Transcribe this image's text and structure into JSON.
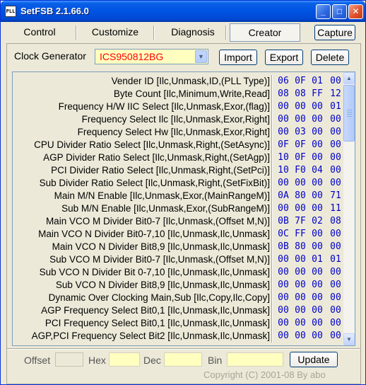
{
  "window": {
    "title": "SetFSB 2.1.66.0",
    "icon_label": "PLL",
    "controls": {
      "minimize": "_",
      "maximize": "□",
      "close": "✕"
    }
  },
  "tabs": [
    {
      "label": "Control",
      "active": false
    },
    {
      "label": "Customize",
      "active": false
    },
    {
      "label": "Diagnosis",
      "active": false
    },
    {
      "label": "Creator",
      "active": true
    }
  ],
  "capture_label": "Capture",
  "clock_generator": {
    "label": "Clock Generator",
    "selected": "ICS950812BG",
    "arrow": "▼",
    "import_label": "Import",
    "export_label": "Export",
    "delete_label": "Delete"
  },
  "rows": [
    {
      "label": "Vender ID [Ilc,Unmask,ID,(PLL Type)]",
      "v": [
        "06",
        "0F",
        "01",
        "00"
      ]
    },
    {
      "label": "Byte Count [Ilc,Minimum,Write,Read]",
      "v": [
        "08",
        "08",
        "FF",
        "12"
      ]
    },
    {
      "label": "Frequency H/W IIC Select [Ilc,Unmask,Exor,(flag)]",
      "v": [
        "00",
        "00",
        "00",
        "01"
      ]
    },
    {
      "label": "Frequency Select Ilc [Ilc,Unmask,Exor,Right]",
      "v": [
        "00",
        "00",
        "00",
        "00"
      ]
    },
    {
      "label": "Frequency Select Hw [Ilc,Unmask,Exor,Right]",
      "v": [
        "00",
        "03",
        "00",
        "00"
      ]
    },
    {
      "label": "CPU Divider Ratio Select [Ilc,Unmask,Right,(SetAsync)]",
      "v": [
        "0F",
        "0F",
        "00",
        "00"
      ]
    },
    {
      "label": "AGP Divider Ratio Select [Ilc,Unmask,Right,(SetAgp)]",
      "v": [
        "10",
        "0F",
        "00",
        "00"
      ]
    },
    {
      "label": "PCI Divider Ratio Select [Ilc,Unmask,Right,(SetPci)]",
      "v": [
        "10",
        "F0",
        "04",
        "00"
      ]
    },
    {
      "label": "Sub Divider Ratio Select [Ilc,Unmask,Right,(SetFixBit)]",
      "v": [
        "00",
        "00",
        "00",
        "00"
      ]
    },
    {
      "label": "Main M/N Enable [Ilc,Unmask,Exor,(MainRangeM)]",
      "v": [
        "0A",
        "80",
        "00",
        "71"
      ]
    },
    {
      "label": "Sub M/N Enable [Ilc,Unmask,Exor,(SubRangeM)]",
      "v": [
        "00",
        "00",
        "00",
        "11"
      ]
    },
    {
      "label": "Main VCO M Divider Bit0-7 [Ilc,Unmask,(Offset M,N)]",
      "v": [
        "0B",
        "7F",
        "02",
        "08"
      ]
    },
    {
      "label": "Main VCO N Divider Bit0-7,10 [Ilc,Unmask,Ilc,Unmask]",
      "v": [
        "0C",
        "FF",
        "00",
        "00"
      ]
    },
    {
      "label": "Main VCO N Divider Bit8,9 [Ilc,Unmask,Ilc,Unmask]",
      "v": [
        "0B",
        "80",
        "00",
        "00"
      ]
    },
    {
      "label": "Sub VCO M Divider Bit0-7 [Ilc,Unmask,(Offset M,N)]",
      "v": [
        "00",
        "00",
        "01",
        "01"
      ]
    },
    {
      "label": "Sub VCO N Divider Bit 0-7,10 [Ilc,Unmask,Ilc,Unmask]",
      "v": [
        "00",
        "00",
        "00",
        "00"
      ]
    },
    {
      "label": "Sub VCO N Divider  Bit8,9 [Ilc,Unmask,Ilc,Unmask]",
      "v": [
        "00",
        "00",
        "00",
        "00"
      ]
    },
    {
      "label": "Dynamic Over Clocking Main,Sub [Ilc,Copy,Ilc,Copy]",
      "v": [
        "00",
        "00",
        "00",
        "00"
      ]
    },
    {
      "label": "AGP Frequency Select Bit0,1 [Ilc,Unmask,Ilc,Unmask]",
      "v": [
        "00",
        "00",
        "00",
        "00"
      ]
    },
    {
      "label": "PCI Frequency Select Bit0,1 [Ilc,Unmask,Ilc,Unmask]",
      "v": [
        "00",
        "00",
        "00",
        "00"
      ]
    },
    {
      "label": "AGP,PCI Frequency Select Bit2 [Ilc,Unmask,Ilc,Unmask]",
      "v": [
        "00",
        "00",
        "00",
        "00"
      ]
    }
  ],
  "fields": {
    "offset_label": "Offset",
    "hex_label": "Hex",
    "dec_label": "Dec",
    "bin_label": "Bin",
    "offset_value": "",
    "hex_value": "",
    "dec_value": "",
    "bin_value": ""
  },
  "update_label": "Update",
  "copyright": "Copyright (C) 2001-08 By abo",
  "colors": {
    "title_bar": "#0054e3",
    "hex_text": "#0000c8",
    "select_text": "#ff0000",
    "field_bg": "#ffffc0"
  }
}
